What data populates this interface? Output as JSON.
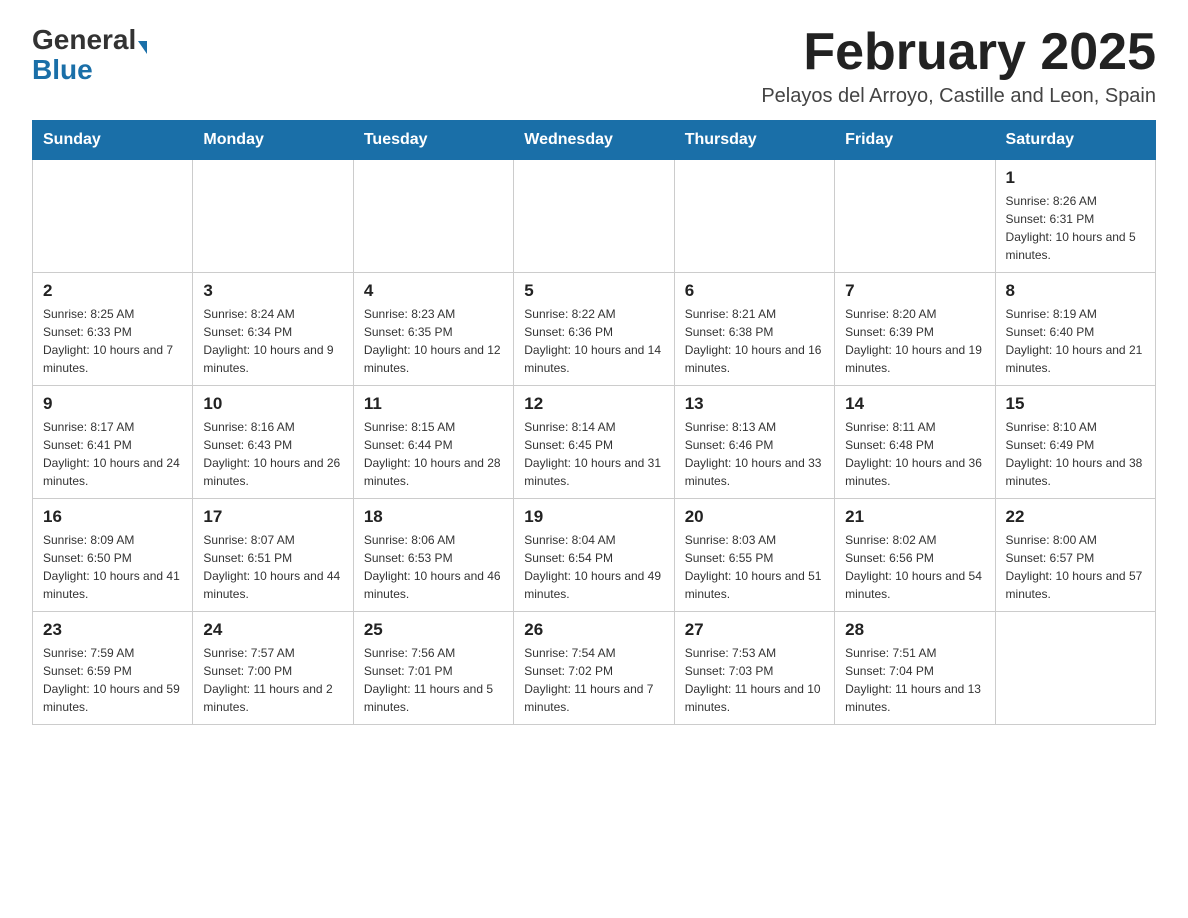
{
  "header": {
    "logo_general": "General",
    "logo_blue": "Blue",
    "month_title": "February 2025",
    "location": "Pelayos del Arroyo, Castille and Leon, Spain"
  },
  "days_of_week": [
    "Sunday",
    "Monday",
    "Tuesday",
    "Wednesday",
    "Thursday",
    "Friday",
    "Saturday"
  ],
  "weeks": [
    [
      {
        "day": "",
        "detail": ""
      },
      {
        "day": "",
        "detail": ""
      },
      {
        "day": "",
        "detail": ""
      },
      {
        "day": "",
        "detail": ""
      },
      {
        "day": "",
        "detail": ""
      },
      {
        "day": "",
        "detail": ""
      },
      {
        "day": "1",
        "detail": "Sunrise: 8:26 AM\nSunset: 6:31 PM\nDaylight: 10 hours and 5 minutes."
      }
    ],
    [
      {
        "day": "2",
        "detail": "Sunrise: 8:25 AM\nSunset: 6:33 PM\nDaylight: 10 hours and 7 minutes."
      },
      {
        "day": "3",
        "detail": "Sunrise: 8:24 AM\nSunset: 6:34 PM\nDaylight: 10 hours and 9 minutes."
      },
      {
        "day": "4",
        "detail": "Sunrise: 8:23 AM\nSunset: 6:35 PM\nDaylight: 10 hours and 12 minutes."
      },
      {
        "day": "5",
        "detail": "Sunrise: 8:22 AM\nSunset: 6:36 PM\nDaylight: 10 hours and 14 minutes."
      },
      {
        "day": "6",
        "detail": "Sunrise: 8:21 AM\nSunset: 6:38 PM\nDaylight: 10 hours and 16 minutes."
      },
      {
        "day": "7",
        "detail": "Sunrise: 8:20 AM\nSunset: 6:39 PM\nDaylight: 10 hours and 19 minutes."
      },
      {
        "day": "8",
        "detail": "Sunrise: 8:19 AM\nSunset: 6:40 PM\nDaylight: 10 hours and 21 minutes."
      }
    ],
    [
      {
        "day": "9",
        "detail": "Sunrise: 8:17 AM\nSunset: 6:41 PM\nDaylight: 10 hours and 24 minutes."
      },
      {
        "day": "10",
        "detail": "Sunrise: 8:16 AM\nSunset: 6:43 PM\nDaylight: 10 hours and 26 minutes."
      },
      {
        "day": "11",
        "detail": "Sunrise: 8:15 AM\nSunset: 6:44 PM\nDaylight: 10 hours and 28 minutes."
      },
      {
        "day": "12",
        "detail": "Sunrise: 8:14 AM\nSunset: 6:45 PM\nDaylight: 10 hours and 31 minutes."
      },
      {
        "day": "13",
        "detail": "Sunrise: 8:13 AM\nSunset: 6:46 PM\nDaylight: 10 hours and 33 minutes."
      },
      {
        "day": "14",
        "detail": "Sunrise: 8:11 AM\nSunset: 6:48 PM\nDaylight: 10 hours and 36 minutes."
      },
      {
        "day": "15",
        "detail": "Sunrise: 8:10 AM\nSunset: 6:49 PM\nDaylight: 10 hours and 38 minutes."
      }
    ],
    [
      {
        "day": "16",
        "detail": "Sunrise: 8:09 AM\nSunset: 6:50 PM\nDaylight: 10 hours and 41 minutes."
      },
      {
        "day": "17",
        "detail": "Sunrise: 8:07 AM\nSunset: 6:51 PM\nDaylight: 10 hours and 44 minutes."
      },
      {
        "day": "18",
        "detail": "Sunrise: 8:06 AM\nSunset: 6:53 PM\nDaylight: 10 hours and 46 minutes."
      },
      {
        "day": "19",
        "detail": "Sunrise: 8:04 AM\nSunset: 6:54 PM\nDaylight: 10 hours and 49 minutes."
      },
      {
        "day": "20",
        "detail": "Sunrise: 8:03 AM\nSunset: 6:55 PM\nDaylight: 10 hours and 51 minutes."
      },
      {
        "day": "21",
        "detail": "Sunrise: 8:02 AM\nSunset: 6:56 PM\nDaylight: 10 hours and 54 minutes."
      },
      {
        "day": "22",
        "detail": "Sunrise: 8:00 AM\nSunset: 6:57 PM\nDaylight: 10 hours and 57 minutes."
      }
    ],
    [
      {
        "day": "23",
        "detail": "Sunrise: 7:59 AM\nSunset: 6:59 PM\nDaylight: 10 hours and 59 minutes."
      },
      {
        "day": "24",
        "detail": "Sunrise: 7:57 AM\nSunset: 7:00 PM\nDaylight: 11 hours and 2 minutes."
      },
      {
        "day": "25",
        "detail": "Sunrise: 7:56 AM\nSunset: 7:01 PM\nDaylight: 11 hours and 5 minutes."
      },
      {
        "day": "26",
        "detail": "Sunrise: 7:54 AM\nSunset: 7:02 PM\nDaylight: 11 hours and 7 minutes."
      },
      {
        "day": "27",
        "detail": "Sunrise: 7:53 AM\nSunset: 7:03 PM\nDaylight: 11 hours and 10 minutes."
      },
      {
        "day": "28",
        "detail": "Sunrise: 7:51 AM\nSunset: 7:04 PM\nDaylight: 11 hours and 13 minutes."
      },
      {
        "day": "",
        "detail": ""
      }
    ]
  ]
}
